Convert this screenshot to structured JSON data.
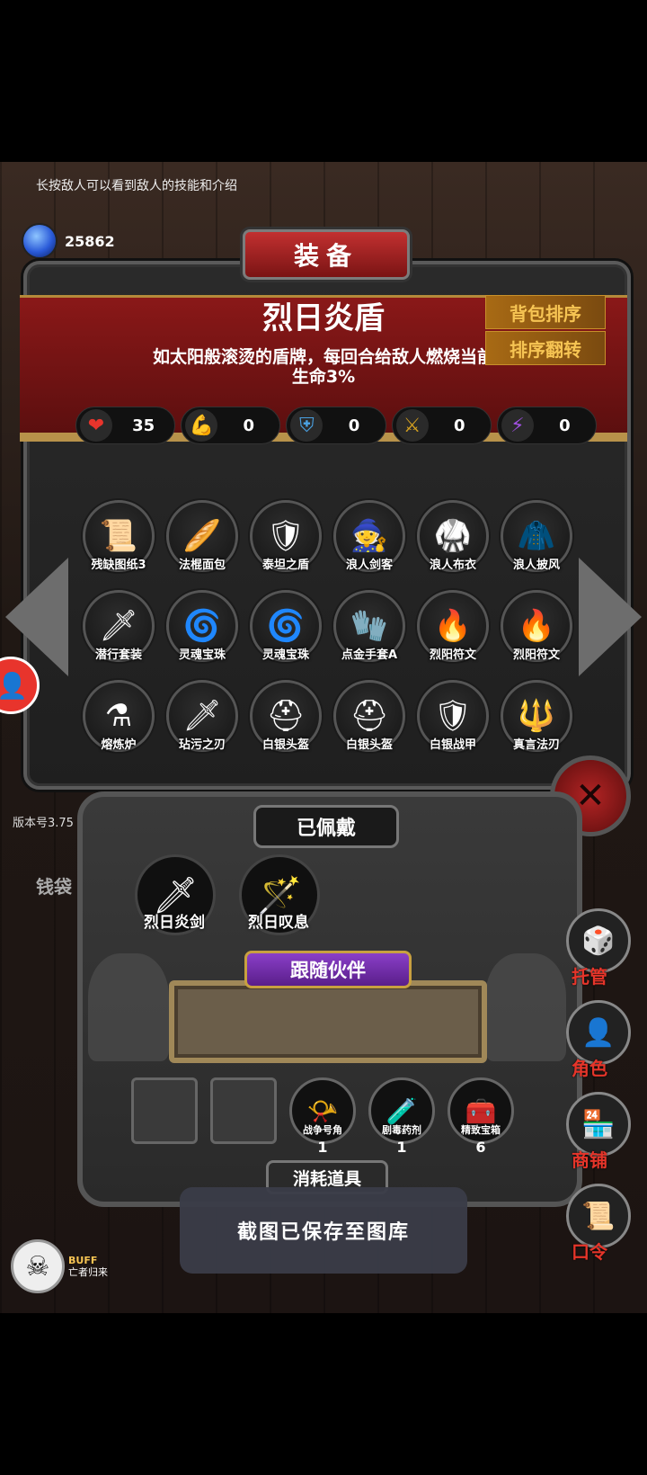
{
  "hint": "长按敌人可以看到敌人的技能和介绍",
  "currency": {
    "value": "25862",
    "icon": "gem-icon"
  },
  "panel": {
    "title": "装备",
    "item_name": "烈日炎盾",
    "item_desc": "如太阳般滚烫的盾牌，每回合给敌人燃烧当前生命3%",
    "sort_button": "背包排序",
    "reverse_button": "排序翻转"
  },
  "stats": [
    {
      "icon": "heart-icon",
      "glyph": "❤",
      "value": "35"
    },
    {
      "icon": "strength-icon",
      "glyph": "💪",
      "value": "0"
    },
    {
      "icon": "armor-icon",
      "glyph": "⛨",
      "value": "0"
    },
    {
      "icon": "sword-icon",
      "glyph": "⚔",
      "value": "0"
    },
    {
      "icon": "lightning-icon",
      "glyph": "⚡",
      "value": "0"
    }
  ],
  "inventory": [
    {
      "label": "残缺图纸3",
      "glyph": "📜"
    },
    {
      "label": "法棍面包",
      "glyph": "🥖"
    },
    {
      "label": "泰坦之盾",
      "glyph": "🛡"
    },
    {
      "label": "浪人剑客",
      "glyph": "🧙"
    },
    {
      "label": "浪人布衣",
      "glyph": "🥋"
    },
    {
      "label": "浪人披风",
      "glyph": "🧥"
    },
    {
      "label": "潜行套装",
      "glyph": "🗡"
    },
    {
      "label": "灵魂宝珠",
      "glyph": "🌀"
    },
    {
      "label": "灵魂宝珠",
      "glyph": "🌀"
    },
    {
      "label": "点金手套A",
      "glyph": "🧤"
    },
    {
      "label": "烈阳符文",
      "glyph": "🔥"
    },
    {
      "label": "烈阳符文",
      "glyph": "🔥"
    },
    {
      "label": "熔炼炉",
      "glyph": "⚗"
    },
    {
      "label": "玷污之刃",
      "glyph": "🗡"
    },
    {
      "label": "白银头盔",
      "glyph": "⛑"
    },
    {
      "label": "白银头盔",
      "glyph": "⛑"
    },
    {
      "label": "白银战甲",
      "glyph": "🛡"
    },
    {
      "label": "真言法刃",
      "glyph": "🔱"
    }
  ],
  "version": "版本号3.75",
  "qiandai": "钱袋",
  "equipped": {
    "title": "已佩戴",
    "items": [
      {
        "label": "烈日炎剑",
        "glyph": "🗡"
      },
      {
        "label": "烈日叹息",
        "glyph": "🪄"
      }
    ]
  },
  "companion": {
    "title": "跟随伙伴"
  },
  "consumables": {
    "title": "消耗道具",
    "items": [
      {
        "label": "",
        "count": "",
        "glyph": ""
      },
      {
        "label": "",
        "count": "",
        "glyph": ""
      },
      {
        "label": "战争号角",
        "count": "1",
        "glyph": "📯"
      },
      {
        "label": "剧毒药剂",
        "count": "1",
        "glyph": "🧪"
      },
      {
        "label": "精致宝箱",
        "count": "6",
        "glyph": "🧰"
      }
    ]
  },
  "right_menu": [
    {
      "label": "托管",
      "icon": "dice-icon",
      "glyph": "🎲"
    },
    {
      "label": "角色",
      "icon": "hood-icon",
      "glyph": "👤"
    },
    {
      "label": "商铺",
      "icon": "shop-icon",
      "glyph": "🏪"
    },
    {
      "label": "口令",
      "icon": "scroll-icon",
      "glyph": "📜"
    }
  ],
  "toast": "截图已保存至图库",
  "buff": {
    "title": "BUFF",
    "text": "亡者归来"
  }
}
